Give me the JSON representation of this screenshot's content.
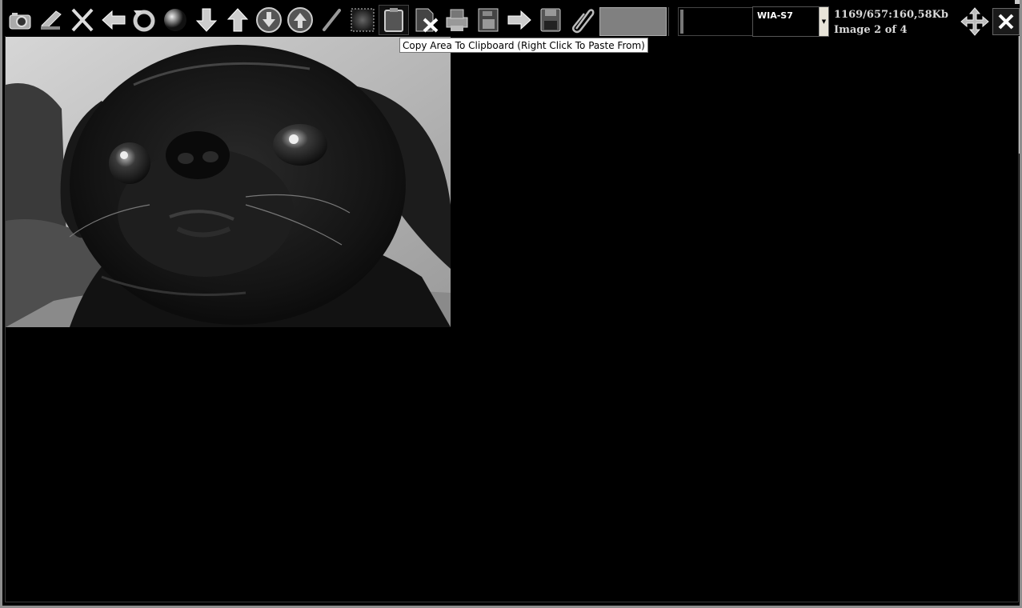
{
  "toolbar": {
    "buttons": [
      {
        "name": "camera-icon"
      },
      {
        "name": "scanner-icon"
      },
      {
        "name": "scissors-icon"
      },
      {
        "name": "arrow-left-icon"
      },
      {
        "name": "rotate-icon"
      },
      {
        "name": "contrast-sphere-icon"
      },
      {
        "name": "arrow-down-icon"
      },
      {
        "name": "arrow-up-icon"
      },
      {
        "name": "circle-arrow-down-icon"
      },
      {
        "name": "circle-arrow-up-icon"
      },
      {
        "name": "pen-icon"
      },
      {
        "name": "select-area-icon"
      },
      {
        "name": "clipboard-icon"
      },
      {
        "name": "delete-page-icon"
      },
      {
        "name": "printer-icon"
      },
      {
        "name": "save-page-icon"
      },
      {
        "name": "arrow-right-icon"
      },
      {
        "name": "floppy-disk-icon"
      },
      {
        "name": "paperclip-icon"
      }
    ],
    "colors": {
      "swatch_gray": "#808080",
      "swatch_black": "#000000"
    }
  },
  "source": {
    "selected": "WIA-S7"
  },
  "info": {
    "dimensions": "1169/657:160,58Kb",
    "image_counter": "Image 2 of 4"
  },
  "tooltip": {
    "text": "Copy Area To Clipboard (Right Click To Paste From)"
  },
  "image": {
    "subject": "black-and-white photo of a dog"
  }
}
